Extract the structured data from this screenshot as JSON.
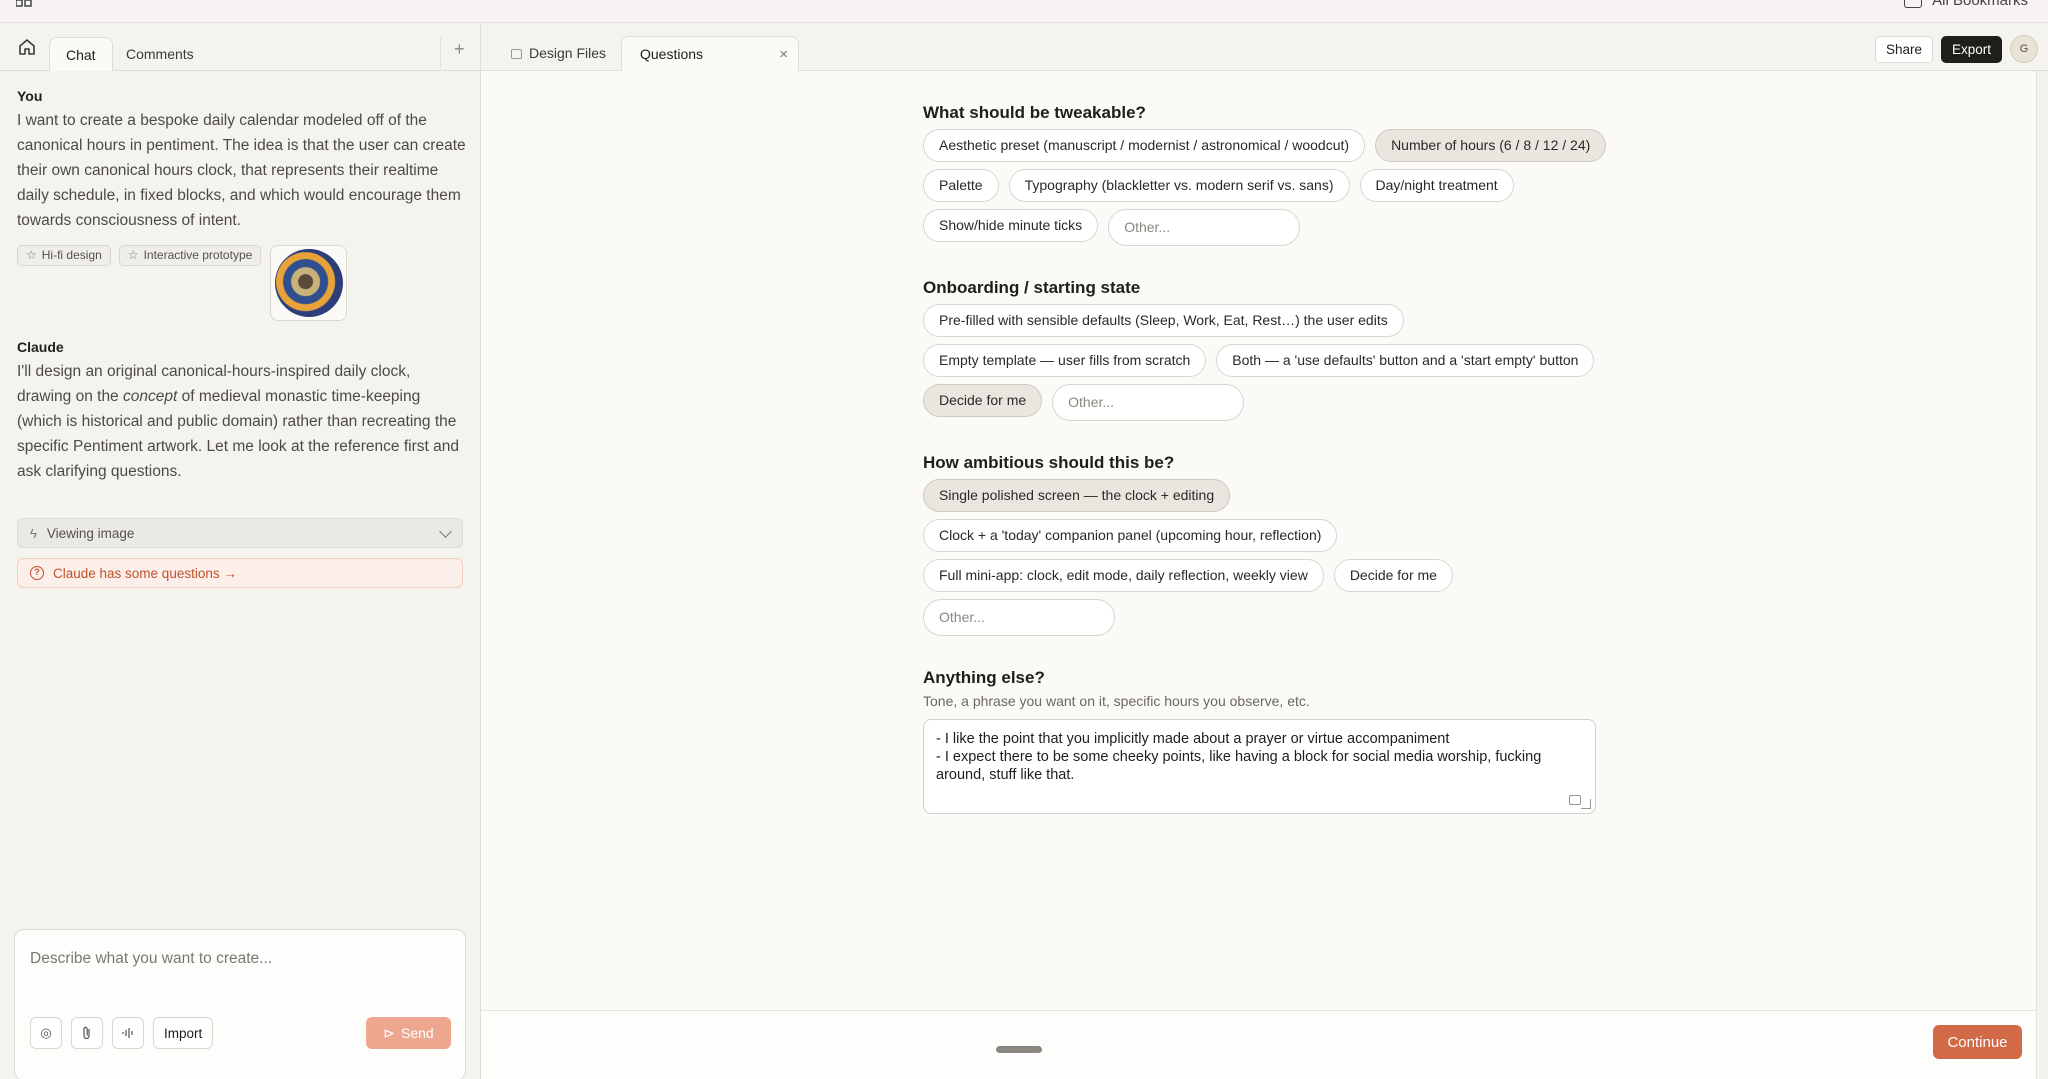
{
  "topbar": {
    "bookmarks_label": "All Bookmarks"
  },
  "left_tabs": {
    "chat": "Chat",
    "comments": "Comments",
    "add": "+"
  },
  "messages": {
    "user_author": "You",
    "user_text": "I want to create a bespoke daily calendar modeled off of the canonical hours in pentiment. The idea is that the user can create their own canonical hours clock, that represents their realtime daily schedule, in fixed blocks, and which would encourage them towards consciousness of intent.",
    "chips": [
      "Hi-fi design",
      "Interactive prototype"
    ],
    "assistant_author": "Claude",
    "assistant_text_1": "I'll design an original canonical-hours-inspired daily clock, drawing on the ",
    "assistant_text_em": "concept",
    "assistant_text_2": " of medieval monastic time-keeping (which is historical and public domain) rather than recreating the specific Pentiment artwork. Let me look at the reference first and ask clarifying questions.",
    "viewing": "Viewing image",
    "questions_link": "Claude has some questions →"
  },
  "composer": {
    "placeholder": "Describe what you want to create...",
    "import": "Import",
    "send": "Send"
  },
  "right_tabs": {
    "design_files": "Design Files",
    "questions": "Questions",
    "close": "×"
  },
  "right_buttons": {
    "share": "Share",
    "export": "Export",
    "avatar": "G"
  },
  "questions": {
    "q1": {
      "title": "What should be tweakable?",
      "options": [
        {
          "label": "Aesthetic preset (manuscript / modernist / astronomical / woodcut)",
          "selected": false
        },
        {
          "label": "Number of hours (6 / 8 / 12 / 24)",
          "selected": true
        },
        {
          "label": "Palette",
          "selected": false
        },
        {
          "label": "Typography (blackletter vs. modern serif vs. sans)",
          "selected": false
        },
        {
          "label": "Day/night treatment",
          "selected": false
        },
        {
          "label": "Show/hide minute ticks",
          "selected": false
        }
      ],
      "other_placeholder": "Other..."
    },
    "q2": {
      "title": "Onboarding / starting state",
      "options": [
        {
          "label": "Pre-filled with sensible defaults (Sleep, Work, Eat, Rest…) the user edits",
          "selected": false
        },
        {
          "label": "Empty template — user fills from scratch",
          "selected": false
        },
        {
          "label": "Both — a 'use defaults' button and a 'start empty' button",
          "selected": false
        },
        {
          "label": "Decide for me",
          "selected": true
        }
      ],
      "other_placeholder": "Other..."
    },
    "q3": {
      "title": "How ambitious should this be?",
      "options": [
        {
          "label": "Single polished screen — the clock + editing",
          "selected": true
        },
        {
          "label": "Clock + a 'today' companion panel (upcoming hour, reflection)",
          "selected": false
        },
        {
          "label": "Full mini-app: clock, edit mode, daily reflection, weekly view",
          "selected": false
        },
        {
          "label": "Decide for me",
          "selected": false
        }
      ],
      "other_placeholder": "Other..."
    },
    "q4": {
      "title": "Anything else?",
      "subtitle": "Tone, a phrase you want on it, specific hours you observe, etc.",
      "value": "- I like the point that you implicitly made about a prayer or virtue accompaniment\n- I expect there to be some cheeky points, like having a block for social media worship, fucking around, stuff like that."
    }
  },
  "footer": {
    "continue": "Continue"
  }
}
